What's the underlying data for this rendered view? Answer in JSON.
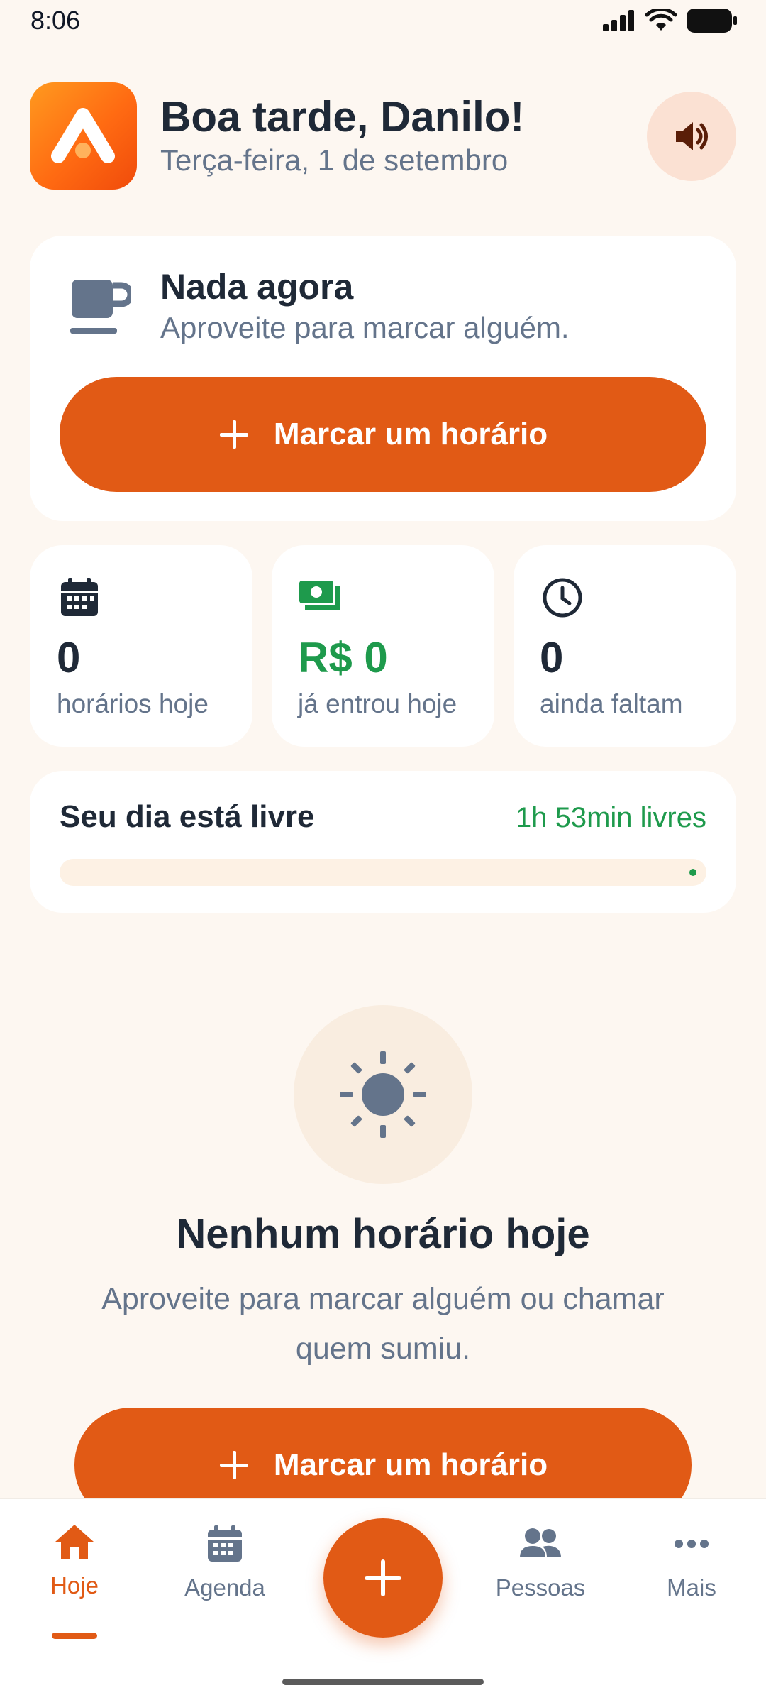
{
  "status_bar": {
    "time": "8:06"
  },
  "header": {
    "greeting": "Boa tarde, Danilo!",
    "date": "Terça-feira, 1 de setembro",
    "sound_icon": "speaker-icon",
    "logo_icon": "app-logo-icon"
  },
  "now_card": {
    "icon": "coffee-cup-icon",
    "title": "Nada agora",
    "subtitle": "Aproveite para marcar alguém.",
    "button_label": "Marcar um horário"
  },
  "stats": [
    {
      "icon": "calendar-icon",
      "value": "0",
      "label": "horários hoje",
      "color": "#1F2937"
    },
    {
      "icon": "money-icon",
      "value": "R$ 0",
      "label": "já entrou hoje",
      "color": "#1E9A4C"
    },
    {
      "icon": "clock-icon",
      "value": "0",
      "label": "ainda faltam",
      "color": "#1F2937"
    }
  ],
  "free_day": {
    "title": "Seu dia está livre",
    "free_time": "1h 53min livres",
    "progress_fraction": 0
  },
  "empty_state": {
    "icon": "sun-icon",
    "title": "Nenhum horário hoje",
    "subtitle": "Aproveite para marcar alguém ou chamar quem sumiu.",
    "button_label": "Marcar um horário"
  },
  "bottom_nav": {
    "items": [
      {
        "label": "Hoje",
        "icon": "home-icon",
        "active": true
      },
      {
        "label": "Agenda",
        "icon": "calendar-icon",
        "active": false
      },
      {
        "label": "Pessoas",
        "icon": "people-icon",
        "active": false
      },
      {
        "label": "Mais",
        "icon": "more-dots-icon",
        "active": false
      }
    ],
    "fab_icon": "plus-icon"
  },
  "colors": {
    "accent": "#E15A15",
    "background": "#FDF7F1",
    "success": "#1E9A4C",
    "muted_text": "#64748B"
  }
}
